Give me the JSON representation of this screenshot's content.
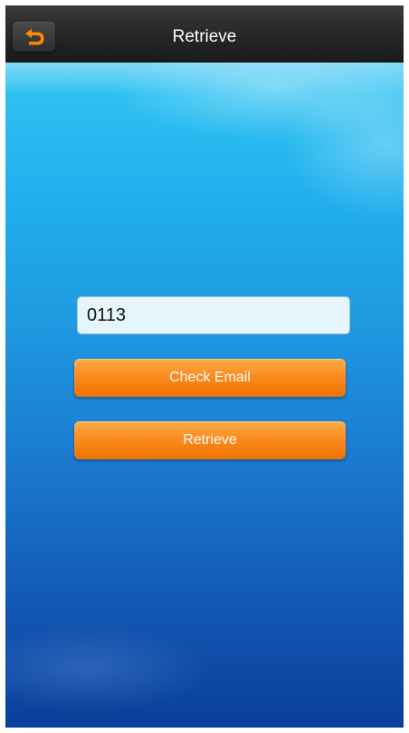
{
  "header": {
    "title": "Retrieve",
    "back_icon": "undo-arrow-icon"
  },
  "form": {
    "code_value": "0113"
  },
  "buttons": {
    "check_email_label": "Check Email",
    "retrieve_label": "Retrieve"
  },
  "colors": {
    "accent_orange": "#f98a1e",
    "back_icon": "#ff8a00",
    "topbar": "#262626",
    "sky_top": "#33c6f2",
    "sky_bottom": "#0a3f98"
  }
}
